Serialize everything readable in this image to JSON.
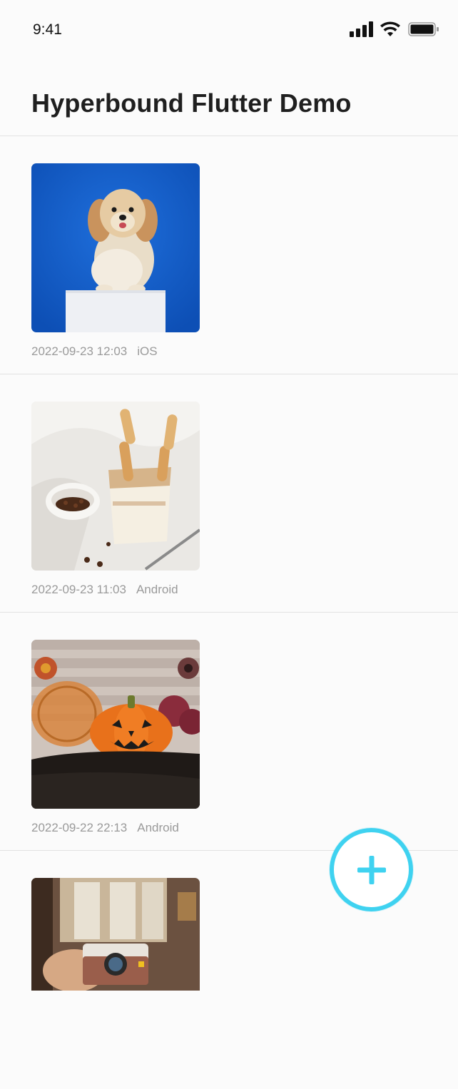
{
  "status_bar": {
    "time": "9:41",
    "icons": [
      "cellular-signal-icon",
      "wifi-icon",
      "battery-icon"
    ]
  },
  "header": {
    "title": "Hyperbound Flutter Demo"
  },
  "feed": {
    "posts": [
      {
        "image": "dog-on-white-box-photo",
        "timestamp": "2022-09-23 12:03",
        "platform": "iOS"
      },
      {
        "image": "tiramisu-dessert-photo",
        "timestamp": "2022-09-23 11:03",
        "platform": "Android"
      },
      {
        "image": "halloween-pumpkin-photo",
        "timestamp": "2022-09-22 22:13",
        "platform": "Android"
      },
      {
        "image": "hand-holding-camera-photo"
      }
    ]
  },
  "fab": {
    "icon": "plus-icon",
    "accent_color": "#3fd2f0"
  }
}
